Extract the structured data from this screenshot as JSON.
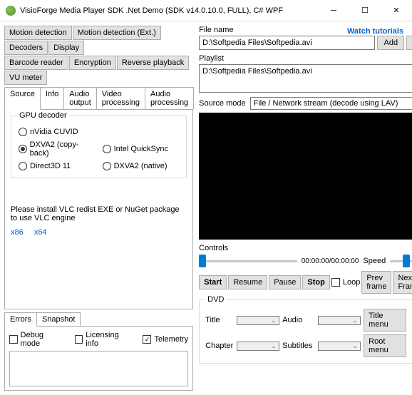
{
  "window": {
    "title": "VisioForge Media Player SDK .Net Demo (SDK v14.0.10.0, FULL), C# WPF"
  },
  "buttons_row1": {
    "motion": "Motion detection",
    "motion_ext": "Motion detection (Ext.)",
    "decoders": "Decoders",
    "display": "Display"
  },
  "buttons_row2": {
    "barcode": "Barcode reader",
    "encryption": "Encryption",
    "reverse": "Reverse playback",
    "vu": "VU meter"
  },
  "tabs": {
    "source": "Source",
    "info": "Info",
    "audio_output": "Audio output",
    "video_processing": "Video processing",
    "audio_processing": "Audio processing"
  },
  "gpu": {
    "title": "GPU decoder",
    "nvidia": "nVidia CUVID",
    "intel": "Intel QuickSync",
    "dxva2_copy": "DXVA2 (copy-back)",
    "dxva2_native": "DXVA2 (native)",
    "d3d11": "Direct3D 11"
  },
  "vlc": {
    "note": "Please install VLC redist EXE or NuGet package to use VLC engine",
    "x86": "x86",
    "x64": "x64"
  },
  "bottom_tabs": {
    "errors": "Errors",
    "snapshot": "Snapshot"
  },
  "checks": {
    "debug": "Debug mode",
    "licensing": "Licensing info",
    "telemetry": "Telemetry"
  },
  "right": {
    "watch": "Watch tutorials",
    "filename_label": "File name",
    "filename": "D:\\Softpedia Files\\Softpedia.avi",
    "add": "Add",
    "browse": "...",
    "playlist_label": "Playlist",
    "playlist_item": "D:\\Softpedia Files\\Softpedia.avi",
    "source_mode": "Source mode",
    "source_value": "File / Network stream (decode using LAV)",
    "controls": "Controls",
    "time": "00:00:00/00:00:00",
    "speed": "Speed",
    "start": "Start",
    "resume": "Resume",
    "pause": "Pause",
    "stop": "Stop",
    "loop": "Loop",
    "prev": "Prev frame",
    "next": "Next Frame",
    "dvd": "DVD",
    "title": "Title",
    "audio": "Audio",
    "title_menu": "Title menu",
    "chapter": "Chapter",
    "subtitles": "Subtitles",
    "root_menu": "Root menu"
  }
}
